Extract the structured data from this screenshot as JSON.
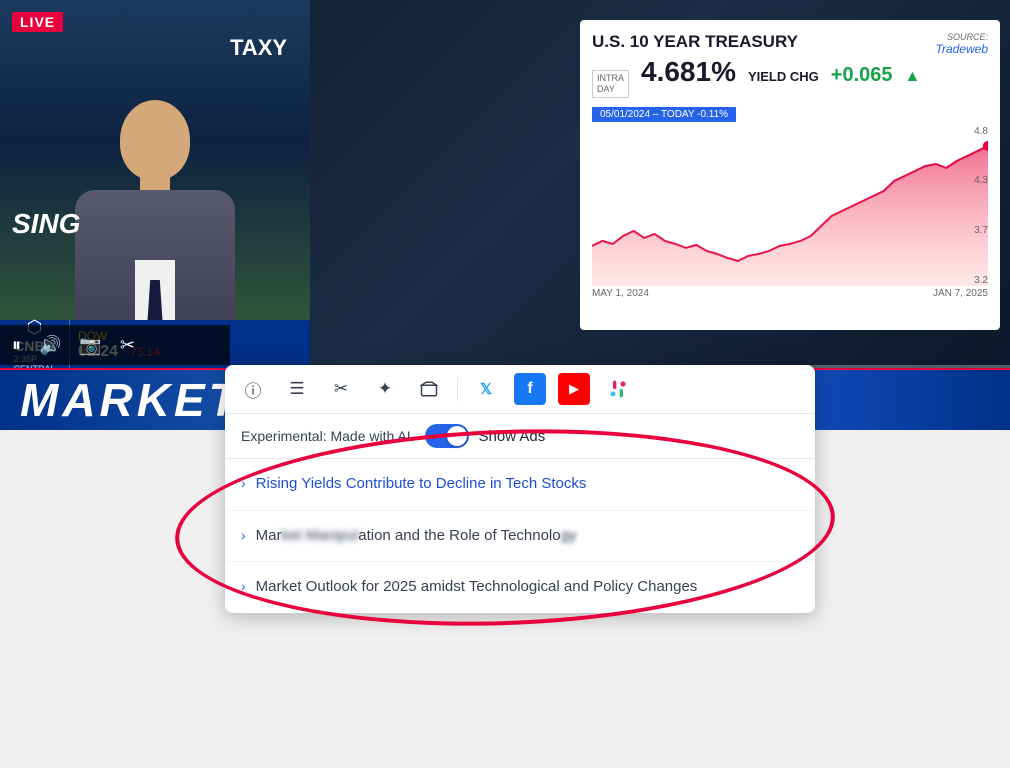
{
  "video": {
    "live_badge": "LIVE",
    "taxy_text": "TAXY",
    "sing_text": "SING"
  },
  "chart": {
    "source_label": "SOURCE:",
    "source_brand": "Tradeweb",
    "title": "U.S. 10 YEAR TREASURY",
    "intraday_label": "INTRA\nDAY",
    "yield_value": "4.681%",
    "yield_chg_label": "YIELD CHG",
    "yield_chg_value": "+0.065",
    "date_range": "05/01/2024 – TODAY  -0.11%",
    "y_axis": [
      "4.8",
      "4.3",
      "3.7",
      "3.2"
    ],
    "x_axis_start": "MAY 1, 2024",
    "x_axis_end": "JAN 7, 2025"
  },
  "cnbc": {
    "logo_text": "CNBC",
    "time": "2:35P\nCENTRAL",
    "ticker_label": "DOW",
    "ticker_value": "02.24",
    "ticker_change": "-73.14"
  },
  "market_alert": {
    "text": "MARKET ALERT"
  },
  "controls": {
    "play_icon": "⏸",
    "volume_icon": "🔊",
    "camera_icon": "📷",
    "scissors_icon": "✂"
  },
  "toolbar": {
    "icons": [
      {
        "name": "info",
        "symbol": "ℹ"
      },
      {
        "name": "menu",
        "symbol": "≡"
      },
      {
        "name": "scissors",
        "symbol": "✂"
      },
      {
        "name": "sparkle",
        "symbol": "✦"
      },
      {
        "name": "archive",
        "symbol": "🗃"
      },
      {
        "name": "twitter",
        "symbol": "𝕏"
      },
      {
        "name": "facebook",
        "symbol": "f"
      },
      {
        "name": "youtube",
        "symbol": "▶"
      },
      {
        "name": "slack",
        "symbol": "#"
      }
    ]
  },
  "toggle": {
    "experimental_label": "Experimental: Made with AI.",
    "show_ads_label": "Show Ads",
    "is_on": true
  },
  "articles": [
    {
      "title": "Rising Yields Contribute to Decline in Tech Stocks",
      "highlighted": true
    },
    {
      "title": "Market Manipulation and the Role of Technology",
      "highlighted": false,
      "truncated": true
    },
    {
      "title": "Market Outlook for 2025 amidst Technological and Policy Changes",
      "highlighted": false
    }
  ],
  "colors": {
    "accent_red": "#e8003d",
    "accent_blue": "#2563eb",
    "cnbc_blue": "#003087",
    "toggle_active": "#2563eb"
  }
}
